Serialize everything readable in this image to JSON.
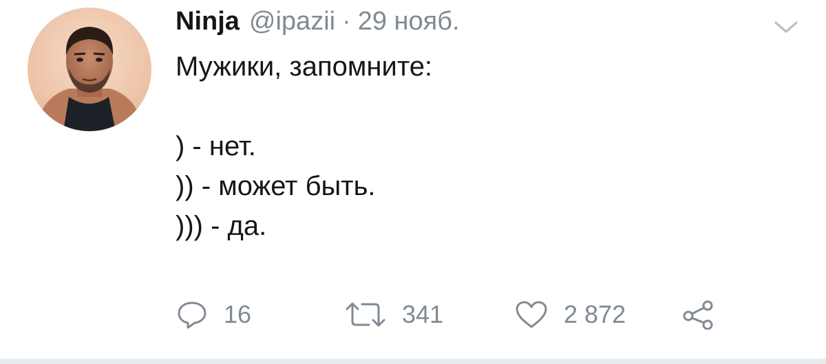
{
  "tweet": {
    "author_name": "Ninja",
    "handle": "@ipazii",
    "separator": "·",
    "date": "29 нояб.",
    "lines": [
      "Мужики, запомните:",
      "",
      ") - нет.",
      ")) - может быть.",
      "))) - да."
    ]
  },
  "actions": {
    "reply_count": "16",
    "retweet_count": "341",
    "like_count": "2 872"
  },
  "icons": {
    "reply": "reply-icon",
    "retweet": "retweet-icon",
    "like": "heart-icon",
    "share": "share-icon",
    "menu": "chevron-down-icon"
  },
  "colors": {
    "text": "#14171a",
    "secondary": "#7f8a94",
    "divider": "#e8ecef"
  }
}
